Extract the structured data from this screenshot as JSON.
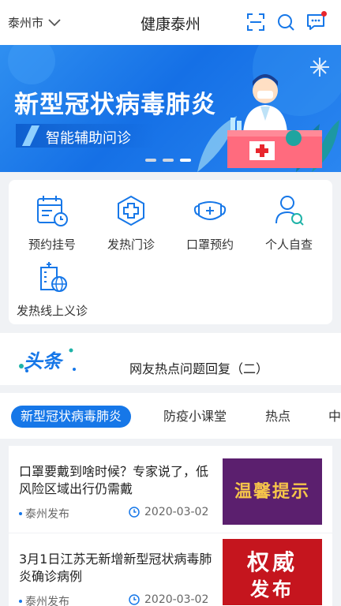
{
  "header": {
    "city": "泰州市",
    "title": "健康泰州",
    "icons": [
      "chevron-down-icon",
      "scan-icon",
      "search-icon",
      "message-icon"
    ]
  },
  "banner": {
    "title": "新型冠状病毒肺炎",
    "subtitle": "智能辅助问诊",
    "active_slide": 3,
    "slide_count": 3
  },
  "menu": {
    "items": [
      {
        "label": "预约挂号",
        "icon": "calendar-icon"
      },
      {
        "label": "发热门诊",
        "icon": "medical-cross-icon"
      },
      {
        "label": "口罩预约",
        "icon": "mask-icon"
      },
      {
        "label": "个人自查",
        "icon": "person-search-icon"
      },
      {
        "label": "发热线上义诊",
        "icon": "hospital-globe-icon"
      }
    ]
  },
  "headline": {
    "logo_text": "头条",
    "text": "网友热点问题回复（二）"
  },
  "tabs": [
    {
      "label": "新型冠状病毒肺炎",
      "active": true
    },
    {
      "label": "防疫小课堂",
      "active": false
    },
    {
      "label": "热点",
      "active": false
    },
    {
      "label": "中",
      "active": false
    }
  ],
  "news": [
    {
      "title": "口罩要戴到啥时候？专家说了，低风险区域出行仍需戴",
      "source": "泰州发布",
      "date": "2020-03-02",
      "thumb_text": "温馨提示"
    },
    {
      "title": "3月1日江苏无新增新型冠状病毒肺炎确诊病例",
      "source": "泰州发布",
      "date": "2020-03-02",
      "thumb_text_1": "权威",
      "thumb_text_2": "发布"
    }
  ],
  "colors": {
    "accent": "#1677e8",
    "banner": "#1570e6",
    "badge": "#e8262d"
  }
}
